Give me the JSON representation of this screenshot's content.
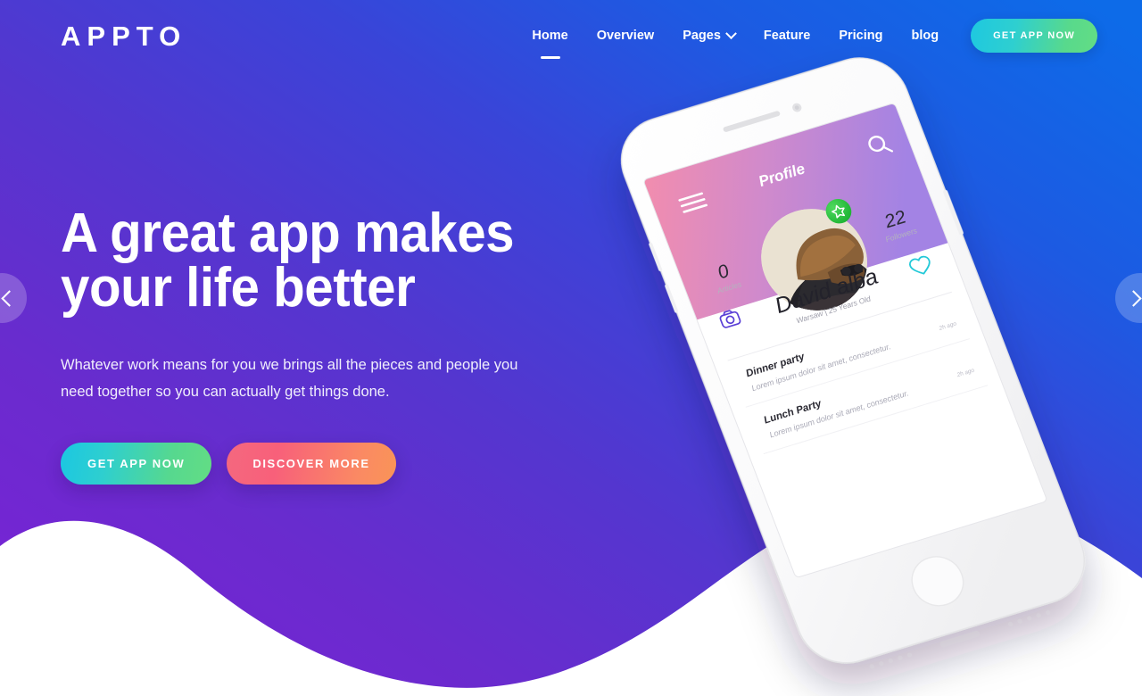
{
  "brand": {
    "logo": "APPTO"
  },
  "nav": {
    "items": [
      {
        "label": "Home",
        "active": true,
        "caret": false
      },
      {
        "label": "Overview",
        "active": false,
        "caret": false
      },
      {
        "label": "Pages",
        "active": false,
        "caret": true
      },
      {
        "label": "Feature",
        "active": false,
        "caret": false
      },
      {
        "label": "Pricing",
        "active": false,
        "caret": false
      },
      {
        "label": "blog",
        "active": false,
        "caret": false
      }
    ],
    "cta_label": "GET APP NOW"
  },
  "hero": {
    "title_line1": "A great app makes",
    "title_line2": "your life better",
    "subtitle_line1": "Whatever work means for you we brings all the pieces and people you",
    "subtitle_line2": "need together so you can actually get things done.",
    "primary_button": "GET APP NOW",
    "secondary_button": "DISCOVER MORE"
  },
  "carousel": {
    "prev_label": "‹",
    "next_label": "›"
  },
  "phone_app": {
    "header_title": "Profile",
    "stats": [
      {
        "value": "0",
        "label": "Articles"
      },
      {
        "value": "22",
        "label": "Followers"
      }
    ],
    "profile_name": "David alba",
    "profile_meta": "Warsaw  |  25 Years Old",
    "feed": [
      {
        "title": "Dinner party",
        "text": "Lorem ipsum dolor sit amet, consectetur.",
        "time": "2h ago"
      },
      {
        "title": "Lunch Party",
        "text": "Lorem ipsum dolor sit amet, consectetur.",
        "time": "2h ago"
      }
    ]
  },
  "colors": {
    "bg_purple": "#6A2BCB",
    "bg_blue": "#1366E0",
    "accent_green": "#55D88D",
    "accent_cyan": "#1BC7E2",
    "accent_pink": "#F4687F",
    "accent_orange": "#FA8F5F",
    "badge_green": "#27C23E"
  }
}
